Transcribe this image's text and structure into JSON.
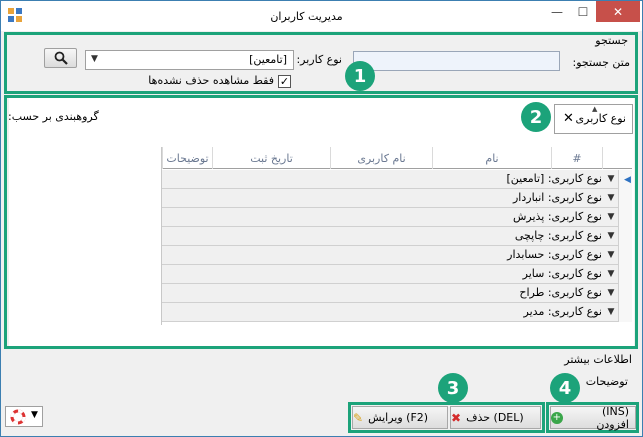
{
  "window": {
    "title": "مدیریت کاربران",
    "controls": {
      "minimize": "—",
      "maximize": "☐",
      "close": "✕"
    }
  },
  "search": {
    "group_title": "جستجو",
    "text_label": "متن جستجو:",
    "text_value": "",
    "user_type_label": "نوع کاربر:",
    "user_type_value": "[تامعین]",
    "only_not_deleted_label": "فقط مشاهده حذف نشده‌ها",
    "only_not_deleted_checked": true,
    "search_button_icon": "magnifier-icon"
  },
  "grouping": {
    "group_by_label": ":گروهبندی بر حسب",
    "chip_label": "نوع کاربری",
    "chip_remove": "✕"
  },
  "grid": {
    "columns": [
      "#",
      "نام",
      "نام کاربری",
      "تاریخ ثبت",
      "توضیحات"
    ],
    "groups": [
      "نوع کاربری: [تامعین]",
      "نوع کاربری: انباردار",
      "نوع کاربری: پذیرش",
      "نوع کاربری: چاپچی",
      "نوع کاربری: حسابدار",
      "نوع کاربری: سایر",
      "نوع کاربری: طراح",
      "نوع کاربری: مدیر"
    ]
  },
  "details": {
    "title": "اطلاعات بیشتر",
    "notes_label": "توضیحات"
  },
  "footer": {
    "add_label": "(INS) افزودن",
    "delete_label": "(DEL) حذف",
    "edit_label": "(F2) ویرایش"
  },
  "annotations": {
    "badge1": "1",
    "badge2": "2",
    "badge3": "3",
    "badge4": "4"
  },
  "colors": {
    "annotation_green": "#1ca37a",
    "close_red": "#c7504a",
    "header_text": "#6a7891"
  }
}
